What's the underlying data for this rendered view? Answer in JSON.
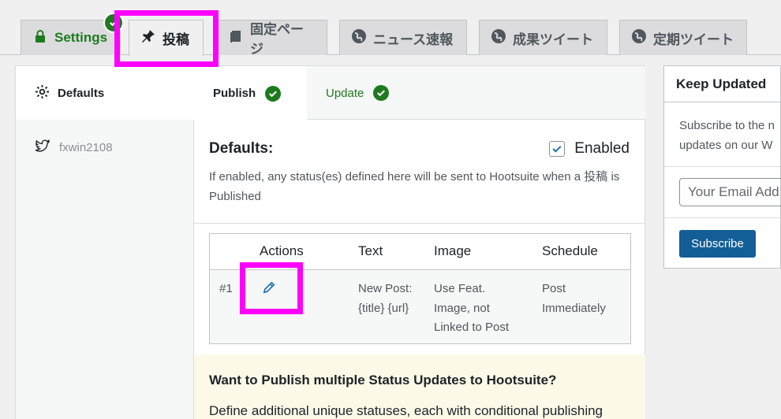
{
  "tabs": [
    {
      "label": "Settings",
      "icon": "lock-icon"
    },
    {
      "label": "投稿",
      "icon": "pushpin-icon"
    },
    {
      "label": "固定ページ",
      "icon": "page-icon"
    },
    {
      "label": "ニュース速報",
      "icon": "globe-icon"
    },
    {
      "label": "成果ツイート",
      "icon": "globe-icon"
    },
    {
      "label": "定期ツイート",
      "icon": "globe-icon"
    }
  ],
  "left": {
    "defaults_label": "Defaults",
    "account": "fxwin2108"
  },
  "subtabs": {
    "publish": "Publish",
    "update": "Update"
  },
  "section": {
    "title": "Defaults:",
    "enabled_label": "Enabled",
    "enabled": true,
    "description": "If enabled, any status(es) defined here will be sent to Hootsuite when a 投稿 is Published"
  },
  "table": {
    "headers": {
      "actions": "Actions",
      "text": "Text",
      "image": "Image",
      "schedule": "Schedule"
    },
    "rows": [
      {
        "index": "#1",
        "text_1": "New Post:",
        "text_2": "{title} {url}",
        "image_1": "Use Feat.",
        "image_2": "Image, not",
        "image_3": "Linked to Post",
        "schedule_1": "Post",
        "schedule_2": "Immediately"
      }
    ]
  },
  "promo": {
    "heading": "Want to Publish multiple Status Updates to Hootsuite?",
    "text": "Define additional unique statuses, each with conditional publishing"
  },
  "sidebar": {
    "title": "Keep Updated",
    "text_1": "Subscribe to the n",
    "text_2": "updates on our W",
    "email_placeholder": "Your Email Add",
    "subscribe": "Subscribe"
  },
  "colors": {
    "accent_green": "#1e7a1e",
    "button_blue": "#135e96",
    "highlight": "#ff00ff"
  }
}
